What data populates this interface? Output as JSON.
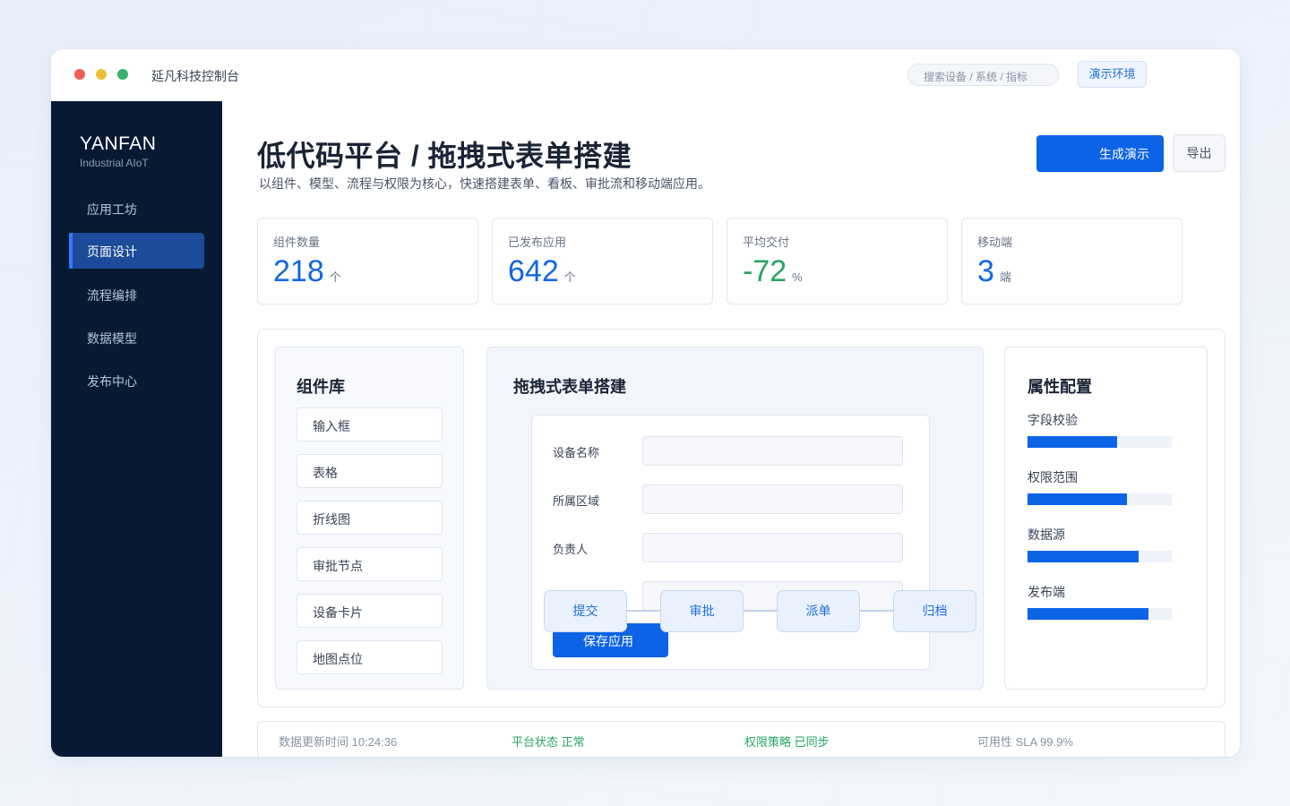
{
  "window": {
    "title": "延凡科技控制台"
  },
  "search": {
    "placeholder": "搜索设备 / 系统 / 指标"
  },
  "env_button": "演示环境",
  "sidebar": {
    "brand": "YANFAN",
    "brand_sub": "Industrial AIoT",
    "items": [
      {
        "label": "应用工坊"
      },
      {
        "label": "页面设计",
        "active": true
      },
      {
        "label": "流程编排"
      },
      {
        "label": "数据模型"
      },
      {
        "label": "发布中心"
      }
    ]
  },
  "header": {
    "title": "低代码平台 / 拖拽式表单搭建",
    "desc": "以组件、模型、流程与权限为核心，快速搭建表单、看板、审批流和移动端应用。",
    "primary_btn": "生成演示",
    "secondary_btn": "导出"
  },
  "stats": [
    {
      "label": "组件数量",
      "value": "218",
      "unit": "个"
    },
    {
      "label": "已发布应用",
      "value": "642",
      "unit": "个"
    },
    {
      "label": "平均交付",
      "value": "-72",
      "unit": "%"
    },
    {
      "label": "移动端",
      "value": "3",
      "unit": "端"
    }
  ],
  "library": {
    "title": "组件库",
    "items": [
      "输入框",
      "表格",
      "折线图",
      "审批节点",
      "设备卡片",
      "地图点位"
    ]
  },
  "canvas": {
    "title": "拖拽式表单搭建",
    "fields": [
      "设备名称",
      "所属区域",
      "负责人"
    ],
    "save_btn": "保存应用",
    "flow": [
      "提交",
      "审批",
      "派单",
      "归档"
    ]
  },
  "properties": {
    "title": "属性配置",
    "items": [
      {
        "label": "字段校验",
        "level": 0.62
      },
      {
        "label": "权限范围",
        "level": 0.69
      },
      {
        "label": "数据源",
        "level": 0.77
      },
      {
        "label": "发布端",
        "level": 0.84
      }
    ]
  },
  "status": {
    "updated": "数据更新时间 10:24:36",
    "platform": "平台状态 正常",
    "policy": "权限策略 已同步",
    "sla": "可用性 SLA 99.9%"
  },
  "colors": {
    "accent": "#0d63e6",
    "sidebar_bg": "#081a33",
    "ok": "#27a563"
  }
}
